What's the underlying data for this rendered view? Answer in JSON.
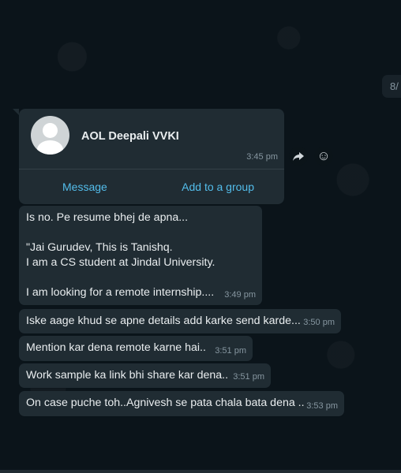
{
  "chat": {
    "date_chip": "8/",
    "contact_card": {
      "name": "AOL Deepali VVKI",
      "time": "3:45 pm",
      "message_button": "Message",
      "add_group_button": "Add to a group",
      "avatar_icon": "default-user-avatar-icon"
    },
    "side_actions": {
      "forward_icon": "forward-icon",
      "emoji_icon": "emoji-icon"
    },
    "messages": [
      {
        "text": "Is no. Pe resume bhej de apna...\n\n\"Jai Gurudev, This is Tanishq.\nI am a CS student at Jindal University.\n\nI am looking for a remote internship....",
        "time": "3:49 pm"
      },
      {
        "text": "Iske aage khud se apne details add karke send karde...",
        "time": "3:50 pm"
      },
      {
        "text": "Mention kar dena remote karne hai..",
        "time": "3:51 pm"
      },
      {
        "text": "Work sample ka link bhi share kar dena..",
        "time": "3:51 pm"
      },
      {
        "text": "On case puche toh..Agnivesh se pata chala bata dena ..",
        "time": "3:53 pm"
      }
    ]
  },
  "colors": {
    "background": "#0b141a",
    "bubble": "#202c33",
    "text": "#e9edef",
    "meta": "#8696a0",
    "link": "#53bdeb"
  }
}
